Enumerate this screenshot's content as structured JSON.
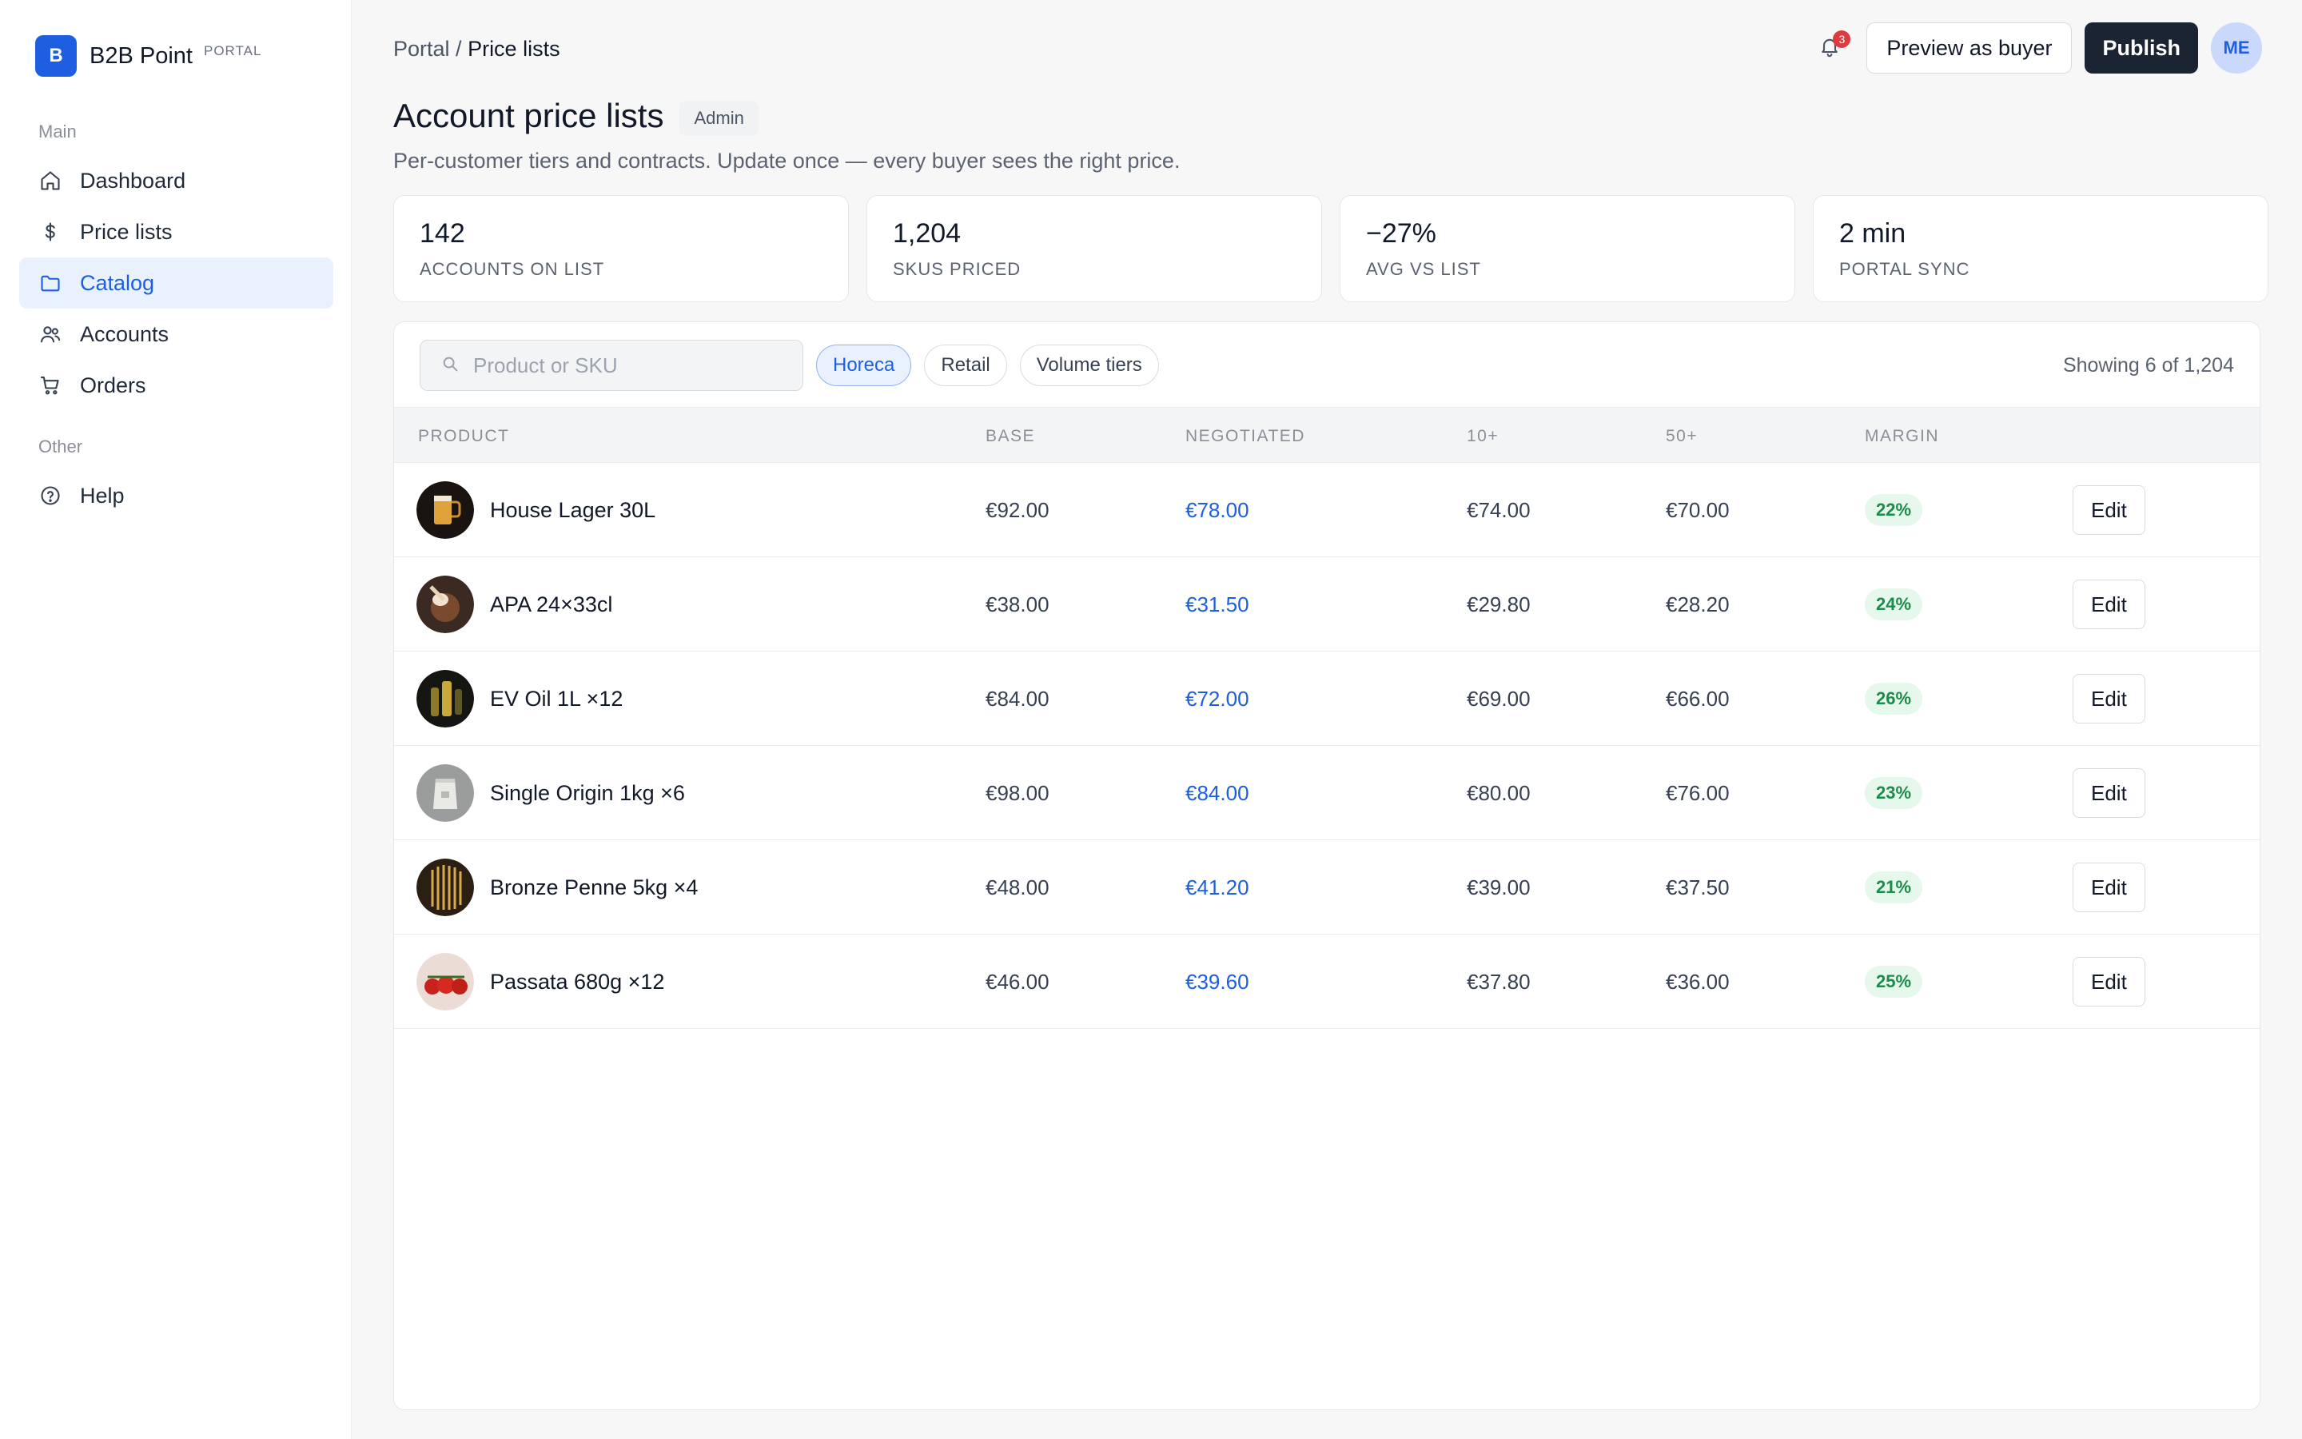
{
  "brand": {
    "logo_letter": "B",
    "name": "B2B Point",
    "tag": "PORTAL"
  },
  "sidebar": {
    "section_main": "Main",
    "section_other": "Other",
    "items": [
      {
        "label": "Dashboard",
        "icon": "home-icon"
      },
      {
        "label": "Price lists",
        "icon": "dollar-icon"
      },
      {
        "label": "Catalog",
        "icon": "folder-icon",
        "active": true
      },
      {
        "label": "Accounts",
        "icon": "users-icon"
      },
      {
        "label": "Orders",
        "icon": "cart-icon"
      }
    ],
    "other_items": [
      {
        "label": "Help",
        "icon": "help-icon"
      }
    ]
  },
  "breadcrumb": {
    "root": "Portal",
    "separator": " / ",
    "current": "Price lists"
  },
  "header": {
    "notification_count": "3",
    "preview_label": "Preview as buyer",
    "publish_label": "Publish",
    "avatar_initials": "ME"
  },
  "page": {
    "title": "Account price lists",
    "role_badge": "Admin",
    "subtitle": "Per-customer tiers and contracts. Update once — every buyer sees the right price."
  },
  "stats": [
    {
      "value": "142",
      "label": "ACCOUNTS ON LIST"
    },
    {
      "value": "1,204",
      "label": "SKUS PRICED"
    },
    {
      "value": "−27%",
      "label": "AVG VS LIST"
    },
    {
      "value": "2 min",
      "label": "PORTAL SYNC"
    }
  ],
  "toolbar": {
    "search_placeholder": "Product or SKU",
    "chips": [
      {
        "label": "Horeca",
        "active": true
      },
      {
        "label": "Retail",
        "active": false
      },
      {
        "label": "Volume tiers",
        "active": false
      }
    ],
    "showing": "Showing 6 of 1,204"
  },
  "table": {
    "columns": [
      "PRODUCT",
      "BASE",
      "NEGOTIATED",
      "10+",
      "50+",
      "MARGIN"
    ],
    "edit_label": "Edit",
    "rows": [
      {
        "product": "House Lager 30L",
        "base": "€92.00",
        "negotiated": "€78.00",
        "tier10": "€74.00",
        "tier50": "€70.00",
        "margin": "22%"
      },
      {
        "product": "APA 24×33cl",
        "base": "€38.00",
        "negotiated": "€31.50",
        "tier10": "€29.80",
        "tier50": "€28.20",
        "margin": "24%"
      },
      {
        "product": "EV Oil 1L ×12",
        "base": "€84.00",
        "negotiated": "€72.00",
        "tier10": "€69.00",
        "tier50": "€66.00",
        "margin": "26%"
      },
      {
        "product": "Single Origin 1kg ×6",
        "base": "€98.00",
        "negotiated": "€84.00",
        "tier10": "€80.00",
        "tier50": "€76.00",
        "margin": "23%"
      },
      {
        "product": "Bronze Penne 5kg ×4",
        "base": "€48.00",
        "negotiated": "€41.20",
        "tier10": "€39.00",
        "tier50": "€37.50",
        "margin": "21%"
      },
      {
        "product": "Passata 680g ×12",
        "base": "€46.00",
        "negotiated": "€39.60",
        "tier10": "€37.80",
        "tier50": "€36.00",
        "margin": "25%"
      }
    ]
  },
  "colors": {
    "accent": "#1d5fe0",
    "dark_button": "#1b2433",
    "margin_green": "#1c8c4a",
    "badge_red": "#e0393e"
  }
}
